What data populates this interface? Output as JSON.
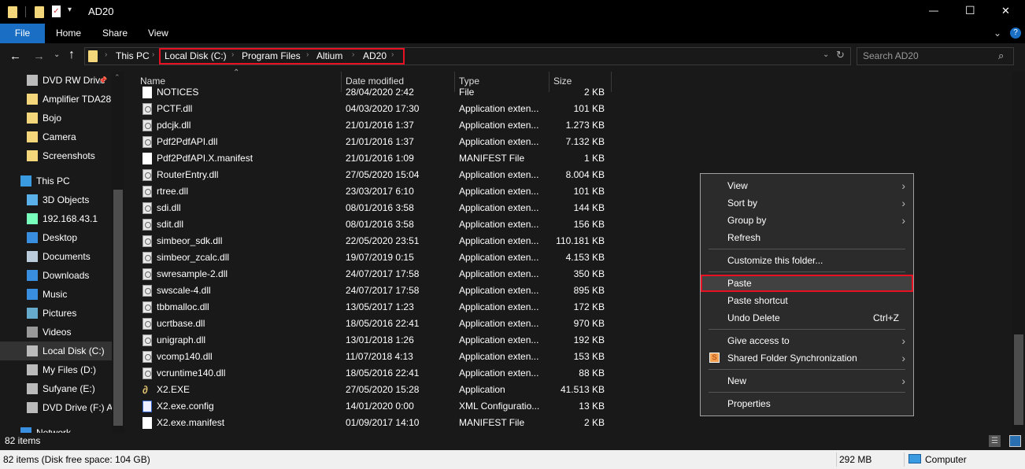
{
  "window": {
    "title": "AD20",
    "minimize": "—",
    "maximize": "☐",
    "close": "✕"
  },
  "ribbon": {
    "tabs": [
      "File",
      "Home",
      "Share",
      "View"
    ],
    "help": "?"
  },
  "address": {
    "crumbs": [
      "This PC",
      "Local Disk (C:)",
      "Program Files",
      "Altium",
      "AD20"
    ],
    "highlight_color": "#e81123"
  },
  "search": {
    "placeholder": "Search AD20"
  },
  "sidebar": {
    "items": [
      {
        "label": "DVD RW Drive",
        "icon": "dvd-icon",
        "pin": "📌"
      },
      {
        "label": "Amplifier TDA28",
        "icon": "folder-icon"
      },
      {
        "label": "Bojo",
        "icon": "folder-icon"
      },
      {
        "label": "Camera",
        "icon": "folder-icon"
      },
      {
        "label": "Screenshots",
        "icon": "folder-icon"
      },
      {
        "label": "This PC",
        "icon": "pc-icon"
      },
      {
        "label": "3D Objects",
        "icon": "cube-icon"
      },
      {
        "label": "192.168.43.1",
        "icon": "network-drive-icon"
      },
      {
        "label": "Desktop",
        "icon": "desktop-icon"
      },
      {
        "label": "Documents",
        "icon": "documents-icon"
      },
      {
        "label": "Downloads",
        "icon": "download-icon"
      },
      {
        "label": "Music",
        "icon": "music-icon"
      },
      {
        "label": "Pictures",
        "icon": "pictures-icon"
      },
      {
        "label": "Videos",
        "icon": "videos-icon"
      },
      {
        "label": "Local Disk (C:)",
        "icon": "disk-icon",
        "selected": true
      },
      {
        "label": "My Files (D:)",
        "icon": "disk-icon"
      },
      {
        "label": "Sufyane (E:)",
        "icon": "disk-icon"
      },
      {
        "label": "DVD Drive (F:) Al",
        "icon": "dvd-icon"
      },
      {
        "label": "Network",
        "icon": "network-icon"
      }
    ]
  },
  "columns": [
    "Name",
    "Date modified",
    "Type",
    "Size"
  ],
  "files": [
    {
      "name": "NOTICES",
      "date": "28/04/2020 2:42",
      "type": "File",
      "size": "2 KB",
      "icon": "file"
    },
    {
      "name": "PCTF.dll",
      "date": "04/03/2020 17:30",
      "type": "Application exten...",
      "size": "101 KB",
      "icon": "dll"
    },
    {
      "name": "pdcjk.dll",
      "date": "21/01/2016 1:37",
      "type": "Application exten...",
      "size": "1.273 KB",
      "icon": "dll"
    },
    {
      "name": "Pdf2PdfAPI.dll",
      "date": "21/01/2016 1:37",
      "type": "Application exten...",
      "size": "7.132 KB",
      "icon": "dll"
    },
    {
      "name": "Pdf2PdfAPI.X.manifest",
      "date": "21/01/2016 1:09",
      "type": "MANIFEST File",
      "size": "1 KB",
      "icon": "file"
    },
    {
      "name": "RouterEntry.dll",
      "date": "27/05/2020 15:04",
      "type": "Application exten...",
      "size": "8.004 KB",
      "icon": "dll"
    },
    {
      "name": "rtree.dll",
      "date": "23/03/2017 6:10",
      "type": "Application exten...",
      "size": "101 KB",
      "icon": "dll"
    },
    {
      "name": "sdi.dll",
      "date": "08/01/2016 3:58",
      "type": "Application exten...",
      "size": "144 KB",
      "icon": "dll"
    },
    {
      "name": "sdit.dll",
      "date": "08/01/2016 3:58",
      "type": "Application exten...",
      "size": "156 KB",
      "icon": "dll"
    },
    {
      "name": "simbeor_sdk.dll",
      "date": "22/05/2020 23:51",
      "type": "Application exten...",
      "size": "110.181 KB",
      "icon": "dll"
    },
    {
      "name": "simbeor_zcalc.dll",
      "date": "19/07/2019 0:15",
      "type": "Application exten...",
      "size": "4.153 KB",
      "icon": "dll"
    },
    {
      "name": "swresample-2.dll",
      "date": "24/07/2017 17:58",
      "type": "Application exten...",
      "size": "350 KB",
      "icon": "dll"
    },
    {
      "name": "swscale-4.dll",
      "date": "24/07/2017 17:58",
      "type": "Application exten...",
      "size": "895 KB",
      "icon": "dll"
    },
    {
      "name": "tbbmalloc.dll",
      "date": "13/05/2017 1:23",
      "type": "Application exten...",
      "size": "172 KB",
      "icon": "dll"
    },
    {
      "name": "ucrtbase.dll",
      "date": "18/05/2016 22:41",
      "type": "Application exten...",
      "size": "970 KB",
      "icon": "dll"
    },
    {
      "name": "unigraph.dll",
      "date": "13/01/2018 1:26",
      "type": "Application exten...",
      "size": "192 KB",
      "icon": "dll"
    },
    {
      "name": "vcomp140.dll",
      "date": "11/07/2018 4:13",
      "type": "Application exten...",
      "size": "153 KB",
      "icon": "dll"
    },
    {
      "name": "vcruntime140.dll",
      "date": "18/05/2016 22:41",
      "type": "Application exten...",
      "size": "88 KB",
      "icon": "dll"
    },
    {
      "name": "X2.EXE",
      "date": "27/05/2020 15:28",
      "type": "Application",
      "size": "41.513 KB",
      "icon": "exe"
    },
    {
      "name": "X2.exe.config",
      "date": "14/01/2020 0:00",
      "type": "XML Configuratio...",
      "size": "13 KB",
      "icon": "config"
    },
    {
      "name": "X2.exe.manifest",
      "date": "01/09/2017 14:10",
      "type": "MANIFEST File",
      "size": "2 KB",
      "icon": "file"
    }
  ],
  "context_menu": {
    "items": [
      {
        "label": "View",
        "submenu": true
      },
      {
        "label": "Sort by",
        "submenu": true
      },
      {
        "label": "Group by",
        "submenu": true
      },
      {
        "label": "Refresh"
      },
      {
        "sep": true
      },
      {
        "label": "Customize this folder..."
      },
      {
        "sep": true
      },
      {
        "label": "Paste",
        "highlighted": true
      },
      {
        "label": "Paste shortcut"
      },
      {
        "label": "Undo Delete",
        "shortcut": "Ctrl+Z"
      },
      {
        "sep": true
      },
      {
        "label": "Give access to",
        "submenu": true
      },
      {
        "label": "Shared Folder Synchronization",
        "submenu": true,
        "icon": "sync-icon"
      },
      {
        "sep": true
      },
      {
        "label": "New",
        "submenu": true
      },
      {
        "sep": true
      },
      {
        "label": "Properties"
      }
    ]
  },
  "status": {
    "items": "82 items",
    "details": "82 items (Disk free space: 104 GB)",
    "size": "292 MB",
    "location": "Computer"
  }
}
